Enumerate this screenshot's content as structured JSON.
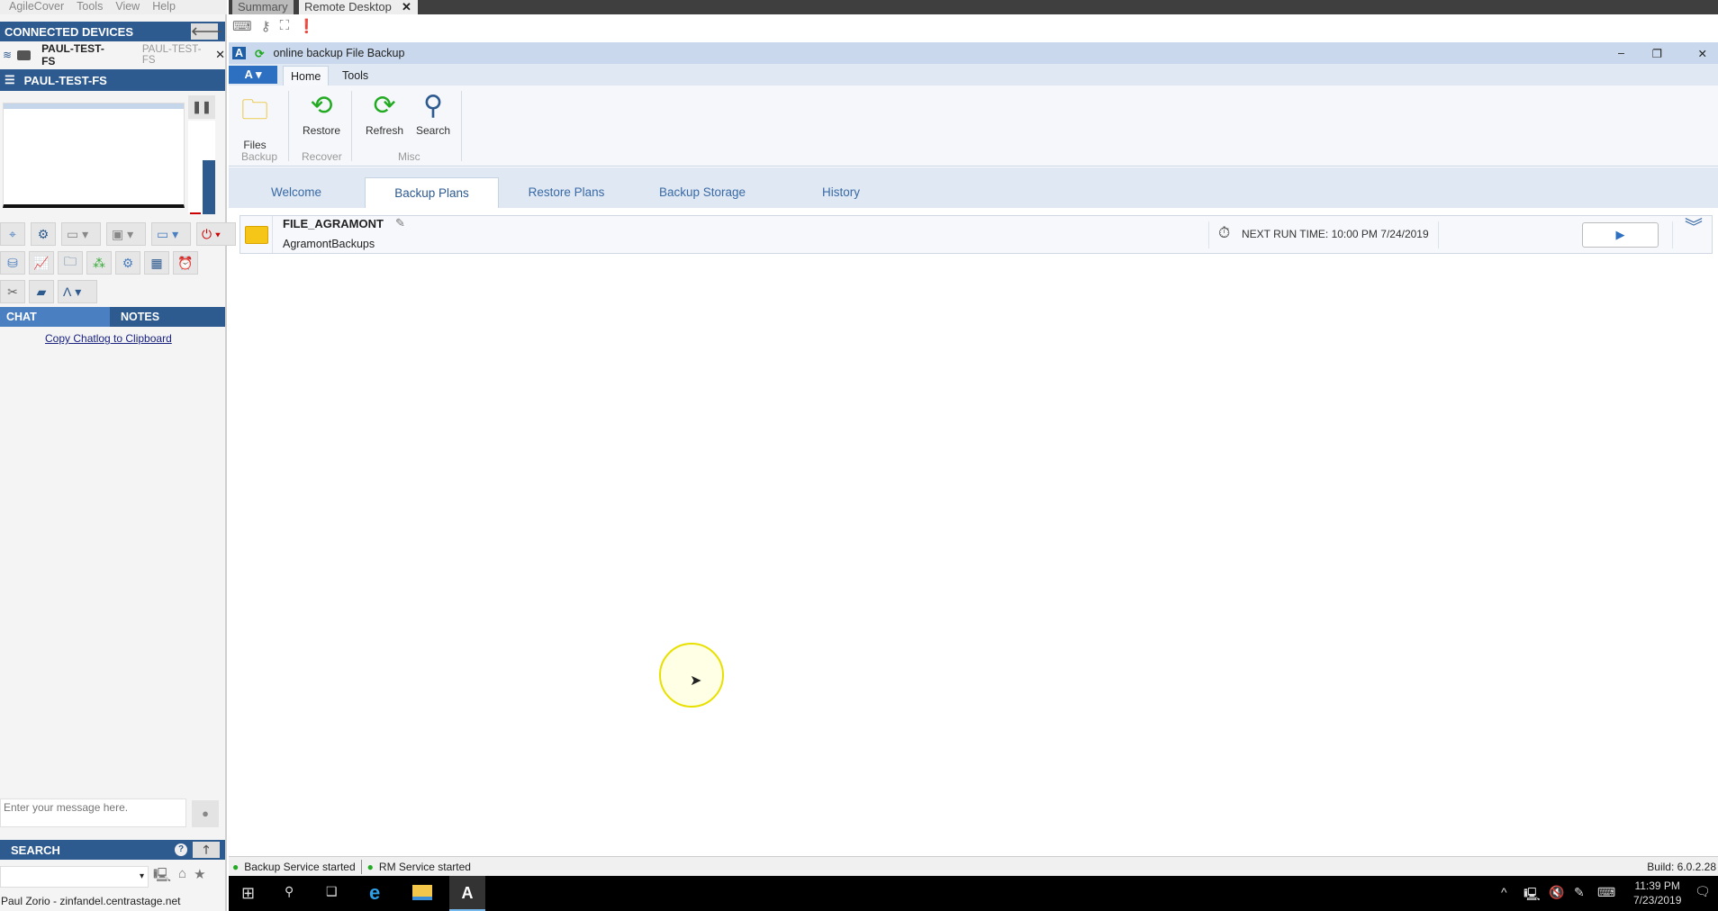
{
  "menu": [
    "AgileCover",
    "Tools",
    "View",
    "Help"
  ],
  "left": {
    "connected_title": "CONNECTED DEVICES",
    "device_name": "PAUL-TEST-FS",
    "device_alias": "PAUL-TEST-FS",
    "session_title": "PAUL-TEST-FS",
    "chat_tab": "CHAT",
    "notes_tab": "NOTES",
    "copy_link": "Copy Chatlog to Clipboard",
    "message_placeholder": "Enter your message here.",
    "search_title": "SEARCH",
    "footer": "Paul Zorio - zinfandel.centrastage.net"
  },
  "session_tabs": [
    "Summary",
    "Remote Desktop"
  ],
  "app": {
    "title": "online backup File Backup",
    "ribbon_tabs": [
      "Home",
      "Tools"
    ],
    "ribbon_buttons": [
      {
        "label": "Files",
        "group": "Backup"
      },
      {
        "label": "Restore",
        "group": "Recover"
      },
      {
        "label": "Refresh",
        "group": "Misc"
      },
      {
        "label": "Search",
        "group": "Misc"
      }
    ],
    "groups": [
      "Backup",
      "Recover",
      "Misc"
    ],
    "nav_tabs": [
      "Welcome",
      "Backup Plans",
      "Restore Plans",
      "Backup Storage",
      "History"
    ],
    "active_nav": "Backup Plans",
    "plan": {
      "name": "FILE_AGRAMONT",
      "storage": "AgramontBackups",
      "next_run": "NEXT RUN TIME: 10:00 PM 7/24/2019"
    },
    "status": [
      "Backup Service started",
      "RM Service started"
    ],
    "build": "Build: 6.0.2.28"
  },
  "taskbar": {
    "time": "11:39 PM",
    "date": "7/23/2019"
  }
}
